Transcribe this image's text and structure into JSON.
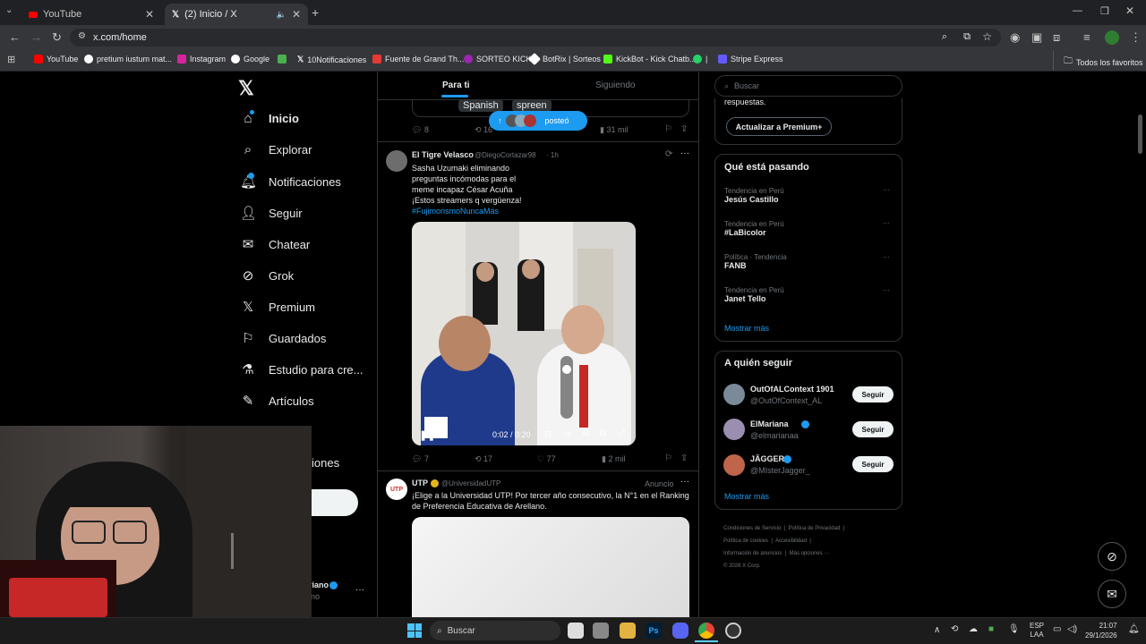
{
  "browser": {
    "tabs": [
      {
        "label": "YouTube"
      },
      {
        "label": "(2) Inicio / X"
      }
    ],
    "url": "x.com/home",
    "bookmarks": [
      "YouTube",
      "pretium iustum mat...",
      "Instagram",
      "Google",
      "10Notificaciones",
      "Fuente de Grand Th...",
      "SORTEO KICK",
      "BotRix | Sorteos",
      "KickBot - Kick Chatb...",
      "|",
      "Stripe Express"
    ],
    "all_bookmarks": "Todos los favoritos"
  },
  "nav": {
    "items": [
      "Inicio",
      "Explorar",
      "Notificaciones",
      "Seguir",
      "Chatear",
      "Grok",
      "Premium",
      "Guardados",
      "Estudio para cre...",
      "Artículos"
    ],
    "partial_item": "iones",
    "account_partial": "ariano",
    "account_handle_partial": "iano",
    "more": "···"
  },
  "feed": {
    "tabs": [
      "Para ti",
      "Siguiendo"
    ],
    "prev_post": {
      "caption_words": [
        "Spanish",
        "spreen"
      ],
      "posted_pill": "posteó",
      "replies": "8",
      "reposts": "16",
      "views": "31 mil"
    },
    "post1": {
      "name": "El Tigre Velasco",
      "handle": "@DiegoCortazar98",
      "time": "· 1h",
      "text_lines": [
        "Sasha Uzumaki eliminando",
        "preguntas incómodas para el",
        "meme incapaz César Acuña",
        "¡Estos streamers q vergüenza!"
      ],
      "hashtag": "#FujimorismoNuncaMás",
      "video_time": "0:02 / 0:20",
      "replies": "7",
      "reposts": "17",
      "likes": "77",
      "views": "2 mil"
    },
    "post2": {
      "name": "UTP",
      "handle": "@UniversidadUTP",
      "label": "Anuncio",
      "text": "¡Elige a la Universidad UTP! Por tercer año consecutivo, la N°1 en el Ranking de Preferencia Educativa de Arellano."
    }
  },
  "right": {
    "search_placeholder": "Buscar",
    "premium_partial": "respuestas.",
    "premium_button": "Actualizar a Premium+",
    "trending_title": "Qué está pasando",
    "trends": [
      {
        "context": "Tendencia en Perú",
        "name": "Jesús Castillo"
      },
      {
        "context": "Tendencia en Perú",
        "name": "#LaBicolor"
      },
      {
        "context": "Política · Tendencia",
        "name": "FANB"
      },
      {
        "context": "Tendencia en Perú",
        "name": "Janet Tello"
      }
    ],
    "show_more": "Mostrar más",
    "follow_title": "A quién seguir",
    "follow": [
      {
        "name": "OutOfALContext 1901",
        "handle": "@OutOfContext_AL",
        "btn": "Seguir"
      },
      {
        "name": "ElMariana",
        "handle": "@elmarianaa",
        "btn": "Seguir"
      },
      {
        "name": "JÄGGER",
        "handle": "@MIsterJagger_",
        "btn": "Seguir"
      }
    ],
    "follow_more": "Mostrar más",
    "footer": [
      "Condiciones de Servicio",
      "Política de Privacidad",
      "Política de cookies",
      "Accesibilidad",
      "Información de anuncios",
      "Más opciones ···",
      "© 2026 X Corp."
    ]
  },
  "taskbar": {
    "search": "Buscar",
    "lang": "ESP",
    "lang2": "LAA",
    "time": "21:07",
    "date": "29/1/2026"
  },
  "colors": {
    "accent": "#1d9bf0",
    "bg": "#000000",
    "chrome": "#35363a"
  }
}
